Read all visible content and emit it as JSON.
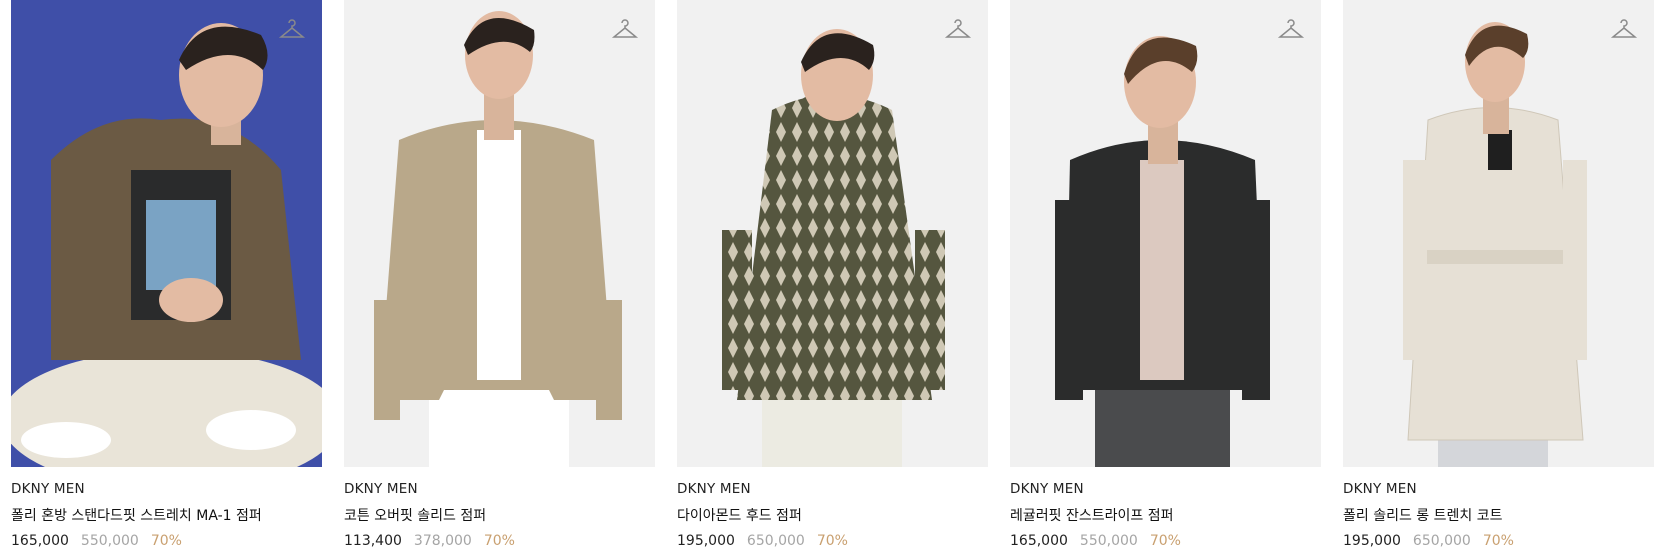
{
  "products": [
    {
      "brand": "DKNY MEN",
      "name": "폴리 혼방 스탠다드핏 스트레치 MA-1 점퍼",
      "price": "165,000",
      "original_price": "550,000",
      "discount": "70%",
      "jacket_color": "#6b5a44",
      "bg_color": "#3f4fa8"
    },
    {
      "brand": "DKNY MEN",
      "name": "코튼 오버핏 솔리드 점퍼",
      "price": "113,400",
      "original_price": "378,000",
      "discount": "70%",
      "jacket_color": "#b9a88a",
      "bg_color": "#f1f1f1"
    },
    {
      "brand": "DKNY MEN",
      "name": "다이아몬드 후드 점퍼",
      "price": "195,000",
      "original_price": "650,000",
      "discount": "70%",
      "jacket_color": "#55563f",
      "bg_color": "#f1f1f1"
    },
    {
      "brand": "DKNY MEN",
      "name": "레귤러핏 잔스트라이프 점퍼",
      "price": "165,000",
      "original_price": "550,000",
      "discount": "70%",
      "jacket_color": "#2b2c2c",
      "bg_color": "#f1f1f1"
    },
    {
      "brand": "DKNY MEN",
      "name": "폴리 솔리드 롱 트렌치 코트",
      "price": "195,000",
      "original_price": "650,000",
      "discount": "70%",
      "jacket_color": "#e6e0d5",
      "bg_color": "#f1f1f1"
    }
  ],
  "icons": {
    "wishlist": "hanger-icon"
  }
}
